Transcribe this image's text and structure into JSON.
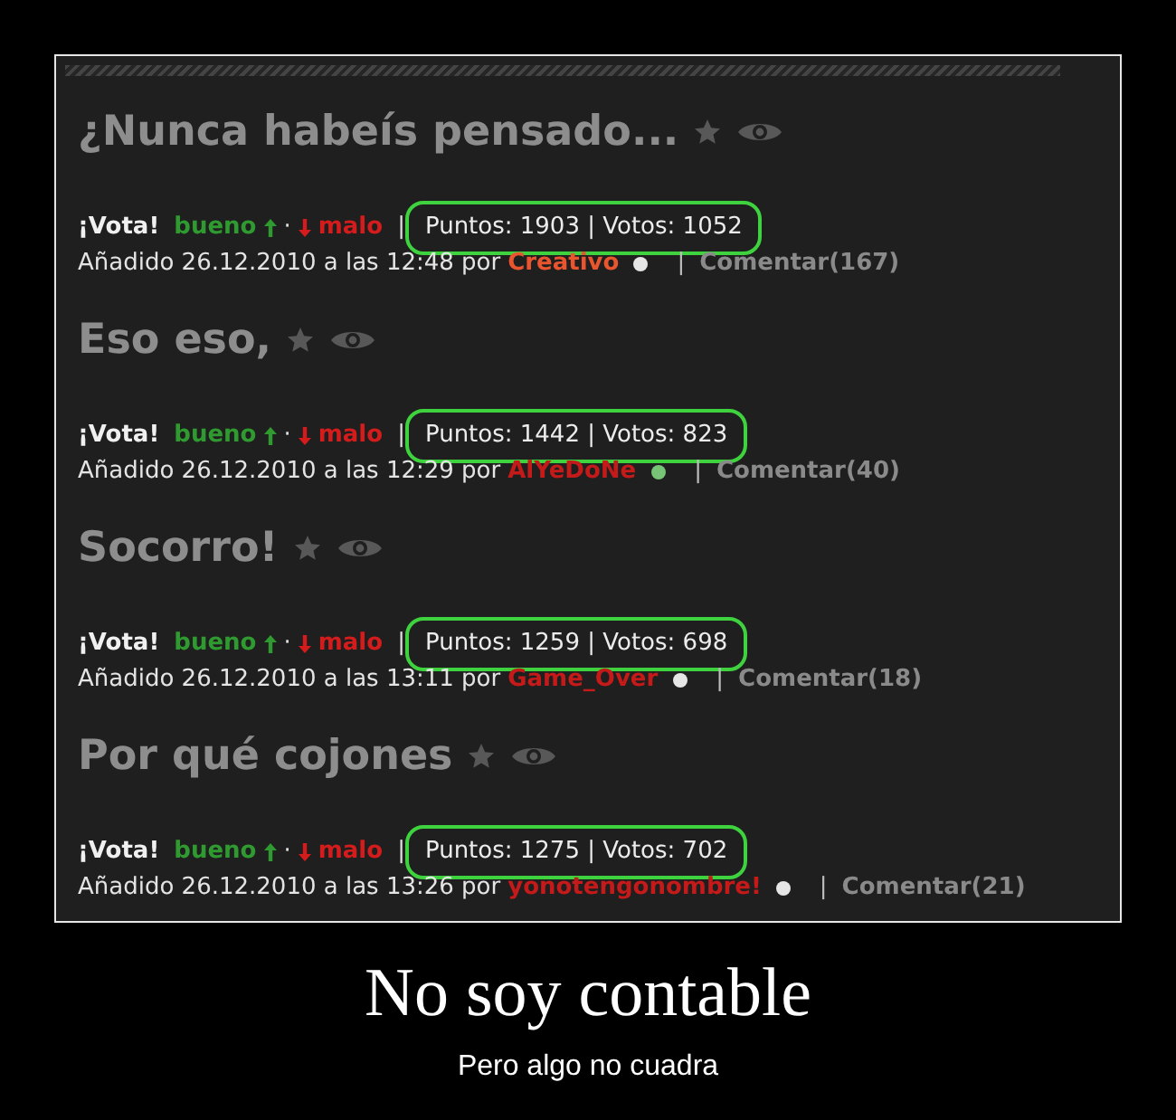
{
  "poster": {
    "screenshot": {
      "posts": [
        {
          "title": "¿Nunca habeís pensado...",
          "vote_label": "¡Vota!",
          "good_vote": "bueno",
          "vote_separator": "·",
          "bad_vote": "malo",
          "score_separator": "|",
          "score": "Puntos: 1903 | Votos: 1052",
          "circled": true,
          "added": "Añadido 26.12.2010 a las 12:48 por",
          "author": {
            "name": "Creativo",
            "color": "#e8552e"
          },
          "status_dot": {
            "color": "#e6e6e6"
          },
          "comment_separator": "|",
          "comments": "Comentar(167)"
        },
        {
          "title": "Eso eso,",
          "vote_label": "¡Vota!",
          "good_vote": "bueno",
          "vote_separator": "·",
          "bad_vote": "malo",
          "score_separator": "|",
          "score": "Puntos: 1442 | Votos: 823",
          "circled": true,
          "added": "Añadido 26.12.2010 a las 12:29 por",
          "author": {
            "name": "AlYeDoNe",
            "color": "#c41a1a"
          },
          "status_dot": {
            "color": "#77c477"
          },
          "comment_separator": "|",
          "comments": "Comentar(40)"
        },
        {
          "title": "Socorro!",
          "vote_label": "¡Vota!",
          "good_vote": "bueno",
          "vote_separator": "·",
          "bad_vote": "malo",
          "score_separator": "|",
          "score": "Puntos: 1259 | Votos: 698",
          "circled": true,
          "added": "Añadido 26.12.2010 a las 13:11 por",
          "author": {
            "name": "Game_Over",
            "color": "#c41a1a"
          },
          "status_dot": {
            "color": "#e6e6e6"
          },
          "comment_separator": "|",
          "comments": "Comentar(18)"
        },
        {
          "title": "Por qué cojones",
          "vote_label": "¡Vota!",
          "good_vote": "bueno",
          "vote_separator": "·",
          "bad_vote": "malo",
          "score_separator": "|",
          "score": "Puntos: 1275 | Votos: 702",
          "circled": true,
          "added": "Añadido 26.12.2010 a las 13:26 por",
          "author": {
            "name": "yonotengonombre!",
            "color": "#c41a1a"
          },
          "status_dot": {
            "color": "#e6e6e6"
          },
          "comment_separator": "|",
          "comments": "Comentar(21)"
        }
      ]
    },
    "title": "No soy contable",
    "subtitle": "Pero algo no cuadra"
  }
}
